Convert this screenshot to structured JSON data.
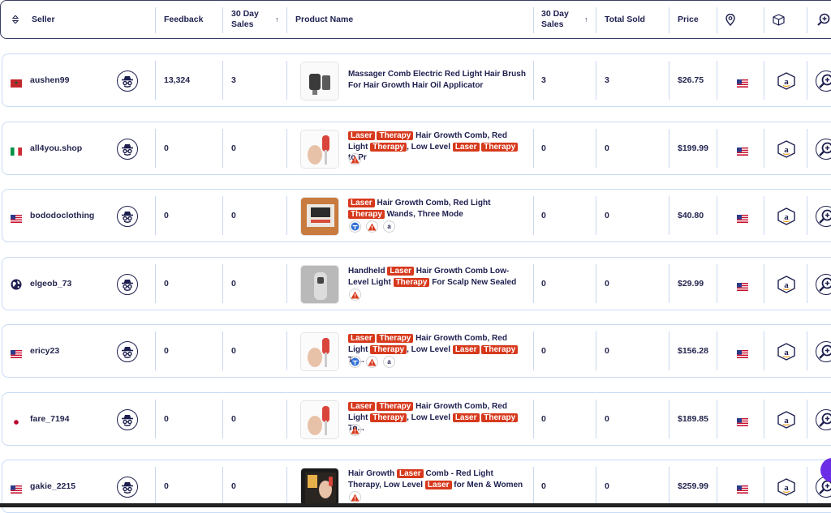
{
  "header": {
    "sort_icon": "sort-updown-icon",
    "seller": "Seller",
    "feedback": "Feedback",
    "sales30_line1": "30 Day",
    "sales30_line2": "Sales",
    "product_name": "Product Name",
    "sales30b_line1": "30 Day",
    "sales30b_line2": "Sales",
    "total_sold": "Total Sold",
    "price": "Price",
    "location_icon": "map-pin-icon",
    "package_icon": "package-icon",
    "search_icon": "zoom-in-icon",
    "sort_arrow": "↑"
  },
  "rows": [
    {
      "seller": "aushen99",
      "flag": "morocco-flag",
      "feedback": "13,324",
      "sales30": "3",
      "product_parts": [
        [
          "t",
          "Massager Comb Electric Red Light Hair Brush For Hair Growth Hair Oil Applicator"
        ]
      ],
      "sales30b": "3",
      "total_sold": "3",
      "price": "$26.75",
      "badges": []
    },
    {
      "seller": "all4you.shop",
      "flag": "italy-flag",
      "feedback": "0",
      "sales30": "0",
      "product_parts": [
        [
          "h",
          "Laser"
        ],
        [
          "t",
          " "
        ],
        [
          "h",
          "Therapy"
        ],
        [
          "t",
          " Hair Growth Comb, Red Light "
        ],
        [
          "h",
          "Therapy"
        ],
        [
          "t",
          ", Low Level "
        ],
        [
          "h",
          "Laser"
        ],
        [
          "t",
          " "
        ],
        [
          "h",
          "Therapy"
        ],
        [
          "t",
          " to Pr"
        ]
      ],
      "sales30b": "0",
      "total_sold": "0",
      "price": "$199.99",
      "badges": [
        "warning"
      ]
    },
    {
      "seller": "bododoclothing",
      "flag": "us-flag",
      "feedback": "0",
      "sales30": "0",
      "product_parts": [
        [
          "h",
          "Laser"
        ],
        [
          "t",
          " Hair Growth Comb, Red Light "
        ],
        [
          "h",
          "Therapy"
        ],
        [
          "t",
          " Wands, Three Mode"
        ]
      ],
      "sales30b": "0",
      "total_sold": "0",
      "price": "$40.80",
      "badges": [
        "brand",
        "warning",
        "amazon"
      ]
    },
    {
      "seller": "elgeob_73",
      "flag": "globe",
      "feedback": "0",
      "sales30": "0",
      "product_parts": [
        [
          "t",
          "Handheld "
        ],
        [
          "h",
          "Laser"
        ],
        [
          "t",
          " Hair Growth Comb Low-Level Light "
        ],
        [
          "h",
          "Therapy"
        ],
        [
          "t",
          " For Scalp New Sealed"
        ]
      ],
      "sales30b": "0",
      "total_sold": "0",
      "price": "$29.99",
      "badges": [
        "warning"
      ]
    },
    {
      "seller": "ericy23",
      "flag": "us-flag",
      "feedback": "0",
      "sales30": "0",
      "product_parts": [
        [
          "h",
          "Laser"
        ],
        [
          "t",
          " "
        ],
        [
          "h",
          "Therapy"
        ],
        [
          "t",
          " Hair Growth Comb, Red Light "
        ],
        [
          "h",
          "Therapy"
        ],
        [
          "t",
          ", Low Level "
        ],
        [
          "h",
          "Laser"
        ],
        [
          "t",
          " "
        ],
        [
          "h",
          "Therapy"
        ],
        [
          "t",
          " To..."
        ]
      ],
      "sales30b": "0",
      "total_sold": "0",
      "price": "$156.28",
      "badges": [
        "brand",
        "warning",
        "amazon"
      ]
    },
    {
      "seller": "fare_7194",
      "flag": "japan-flag",
      "feedback": "0",
      "sales30": "0",
      "product_parts": [
        [
          "h",
          "Laser"
        ],
        [
          "t",
          " "
        ],
        [
          "h",
          "Therapy"
        ],
        [
          "t",
          " Hair Growth Comb, Red Light "
        ],
        [
          "h",
          "Therapy"
        ],
        [
          "t",
          ", Low Level "
        ],
        [
          "h",
          "Laser"
        ],
        [
          "t",
          " "
        ],
        [
          "h",
          "Therapy"
        ],
        [
          "t",
          " To..."
        ]
      ],
      "sales30b": "0",
      "total_sold": "0",
      "price": "$189.85",
      "badges": [
        "warning"
      ]
    },
    {
      "seller": "gakie_2215",
      "flag": "us-flag",
      "feedback": "0",
      "sales30": "0",
      "product_parts": [
        [
          "t",
          "Hair Growth "
        ],
        [
          "h",
          "Laser"
        ],
        [
          "t",
          " Comb - Red Light Therapy, Low Level "
        ],
        [
          "h",
          "Laser"
        ],
        [
          "t",
          " for Men & Women"
        ]
      ],
      "sales30b": "0",
      "total_sold": "0",
      "price": "$259.99",
      "badges": [
        "warning"
      ]
    }
  ],
  "colors": {
    "highlight": "#d7391c",
    "border": "#c7dbf5",
    "text": "#1d1f4f",
    "chat": "#6b2ee6"
  }
}
